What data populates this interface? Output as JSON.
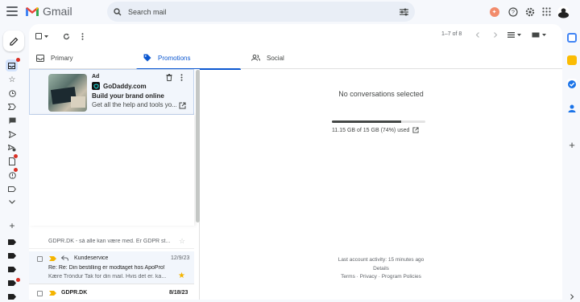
{
  "header": {
    "app_name": "Gmail",
    "search_placeholder": "Search mail",
    "icons": [
      "menu-icon",
      "gmail-logo",
      "search-icon",
      "search-options-icon",
      "gemini-badge-icon",
      "help-icon",
      "settings-icon",
      "apps-icon",
      "avatar"
    ]
  },
  "toolbar": {
    "pager_text": "1–7 of 8"
  },
  "tabs": [
    {
      "label": "Primary",
      "active": false
    },
    {
      "label": "Promotions",
      "active": true
    },
    {
      "label": "Social",
      "active": false
    }
  ],
  "ad": {
    "tag": "Ad",
    "brand": "GoDaddy.com",
    "headline": "Build your brand online",
    "description": "Get all the help and tools yo..."
  },
  "emails": [
    {
      "sender": "",
      "snippet": "GDPR.DK - så alle kan være med. Er GDPR st...",
      "date": "",
      "starred": false
    },
    {
      "sender": "Kundeservice",
      "subject": "Re: Re: Din bestilling er modtaget hos ApoPro!",
      "snippet": "Kære Tróndur Tak for din mail. Hvis det er. ka...",
      "date": "12/9/23",
      "starred": true
    },
    {
      "sender": "GDPR.DK",
      "date": "8/18/23",
      "starred": false
    }
  ],
  "detail": {
    "empty_text": "No conversations selected",
    "storage_text": "11.15 GB of 15 GB (74%) used",
    "storage_fraction": 0.74
  },
  "footer": {
    "activity": "Last account activity: 15 minutes ago",
    "details": "Details",
    "links": "Terms · Privacy · Program Policies"
  },
  "colors": {
    "accent": "#0b57d0",
    "unread_dot": "#d93025",
    "star": "#f4b400"
  }
}
